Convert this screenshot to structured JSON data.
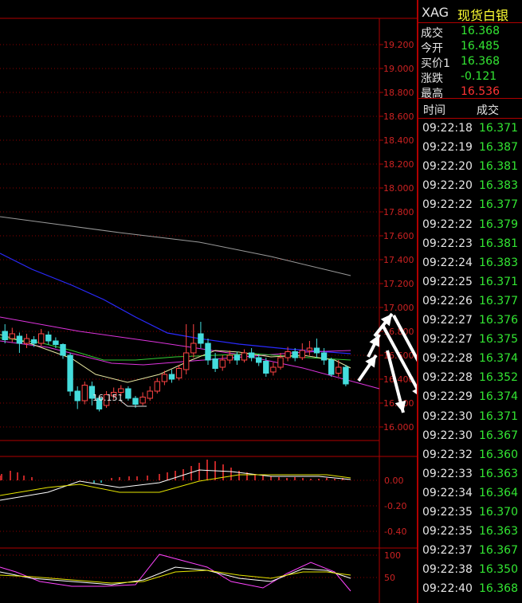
{
  "quote": {
    "symbol": "XAG",
    "name": "现货白银",
    "rows": [
      {
        "label": "成交",
        "value": "16.368",
        "color": "#33e633"
      },
      {
        "label": "今开",
        "value": "16.485",
        "color": "#33e633"
      },
      {
        "label": "买价1",
        "value": "16.368",
        "color": "#33e633"
      },
      {
        "label": "涨跌",
        "value": "-0.121",
        "color": "#33e633"
      },
      {
        "label": "最高",
        "value": "16.536",
        "color": "#ff3333"
      }
    ]
  },
  "ticks_header": {
    "time": "时间",
    "price": "成交"
  },
  "ticks": [
    {
      "time": "09:22:18",
      "price": "16.371"
    },
    {
      "time": "09:22:19",
      "price": "16.387"
    },
    {
      "time": "09:22:20",
      "price": "16.381"
    },
    {
      "time": "09:22:20",
      "price": "16.383"
    },
    {
      "time": "09:22:22",
      "price": "16.377"
    },
    {
      "time": "09:22:22",
      "price": "16.379"
    },
    {
      "time": "09:22:23",
      "price": "16.381"
    },
    {
      "time": "09:22:24",
      "price": "16.383"
    },
    {
      "time": "09:22:25",
      "price": "16.371"
    },
    {
      "time": "09:22:26",
      "price": "16.377"
    },
    {
      "time": "09:22:27",
      "price": "16.376"
    },
    {
      "time": "09:22:27",
      "price": "16.375"
    },
    {
      "time": "09:22:28",
      "price": "16.374"
    },
    {
      "time": "09:22:28",
      "price": "16.352"
    },
    {
      "time": "09:22:29",
      "price": "16.374"
    },
    {
      "time": "09:22:30",
      "price": "16.371"
    },
    {
      "time": "09:22:30",
      "price": "16.367"
    },
    {
      "time": "09:22:32",
      "price": "16.360"
    },
    {
      "time": "09:22:33",
      "price": "16.363"
    },
    {
      "time": "09:22:34",
      "price": "16.364"
    },
    {
      "time": "09:22:35",
      "price": "16.370"
    },
    {
      "time": "09:22:35",
      "price": "16.363"
    },
    {
      "time": "09:22:37",
      "price": "16.367"
    },
    {
      "time": "09:22:38",
      "price": "16.350"
    },
    {
      "time": "09:22:40",
      "price": "16.368"
    }
  ],
  "chart_data": [
    {
      "type": "candlestick",
      "y_ticks": [
        "19.200",
        "19.000",
        "18.800",
        "18.600",
        "18.400",
        "18.200",
        "18.000",
        "17.800",
        "17.600",
        "17.400",
        "17.200",
        "17.000",
        "16.800",
        "16.600",
        "16.400",
        "16.200",
        "16.000"
      ],
      "ylim": [
        16.0,
        19.2
      ],
      "low_label": "16.151",
      "candles": [
        [
          16.8,
          16.73,
          16.86,
          16.7
        ],
        [
          16.74,
          16.78,
          16.83,
          16.71
        ],
        [
          16.76,
          16.7,
          16.79,
          16.62
        ],
        [
          16.7,
          16.74,
          16.78,
          16.66
        ],
        [
          16.73,
          16.7,
          16.76,
          16.67
        ],
        [
          16.7,
          16.78,
          16.82,
          16.68
        ],
        [
          16.77,
          16.72,
          16.8,
          16.69
        ],
        [
          16.72,
          16.69,
          16.75,
          16.66
        ],
        [
          16.69,
          16.6,
          16.7,
          16.57
        ],
        [
          16.6,
          16.3,
          16.62,
          16.26
        ],
        [
          16.3,
          16.22,
          16.34,
          16.15
        ],
        [
          16.22,
          16.35,
          16.38,
          16.19
        ],
        [
          16.34,
          16.24,
          16.38,
          16.18
        ],
        [
          16.24,
          16.15,
          16.26,
          16.13
        ],
        [
          16.18,
          16.27,
          16.3,
          16.16
        ],
        [
          16.26,
          16.29,
          16.33,
          16.23
        ],
        [
          16.29,
          16.32,
          16.35,
          16.26
        ],
        [
          16.32,
          16.24,
          16.34,
          16.22
        ],
        [
          16.24,
          16.19,
          16.26,
          16.16
        ],
        [
          16.2,
          16.25,
          16.29,
          16.18
        ],
        [
          16.24,
          16.3,
          16.34,
          16.22
        ],
        [
          16.3,
          16.38,
          16.41,
          16.28
        ],
        [
          16.38,
          16.44,
          16.47,
          16.35
        ],
        [
          16.44,
          16.4,
          16.48,
          16.37
        ],
        [
          16.41,
          16.49,
          16.52,
          16.39
        ],
        [
          16.48,
          16.62,
          16.86,
          16.44
        ],
        [
          16.62,
          16.7,
          16.86,
          16.58
        ],
        [
          16.78,
          16.7,
          16.88,
          16.66
        ],
        [
          16.7,
          16.56,
          16.74,
          16.52
        ],
        [
          16.57,
          16.49,
          16.62,
          16.46
        ],
        [
          16.5,
          16.56,
          16.6,
          16.47
        ],
        [
          16.56,
          16.6,
          16.64,
          16.53
        ],
        [
          16.6,
          16.56,
          16.63,
          16.52
        ],
        [
          16.56,
          16.62,
          16.65,
          16.54
        ],
        [
          16.62,
          16.58,
          16.66,
          16.55
        ],
        [
          16.58,
          16.54,
          16.61,
          16.51
        ],
        [
          16.55,
          16.45,
          16.58,
          16.42
        ],
        [
          16.46,
          16.5,
          16.54,
          16.43
        ],
        [
          16.5,
          16.58,
          16.62,
          16.48
        ],
        [
          16.58,
          16.63,
          16.67,
          16.55
        ],
        [
          16.63,
          16.58,
          16.66,
          16.55
        ],
        [
          16.58,
          16.64,
          16.7,
          16.56
        ],
        [
          16.64,
          16.66,
          16.72,
          16.6
        ],
        [
          16.66,
          16.62,
          16.74,
          16.58
        ],
        [
          16.62,
          16.56,
          16.66,
          16.52
        ],
        [
          16.56,
          16.44,
          16.58,
          16.42
        ],
        [
          16.45,
          16.5,
          16.56,
          16.42
        ],
        [
          16.5,
          16.36,
          16.52,
          16.34
        ]
      ]
    },
    {
      "type": "line",
      "y_ticks": [
        "0.00",
        "-0.20",
        "-0.40"
      ],
      "ylim": [
        -0.4,
        0.2
      ]
    },
    {
      "type": "line",
      "y_ticks": [
        "100",
        "50"
      ],
      "ylim": [
        0,
        100
      ]
    }
  ]
}
